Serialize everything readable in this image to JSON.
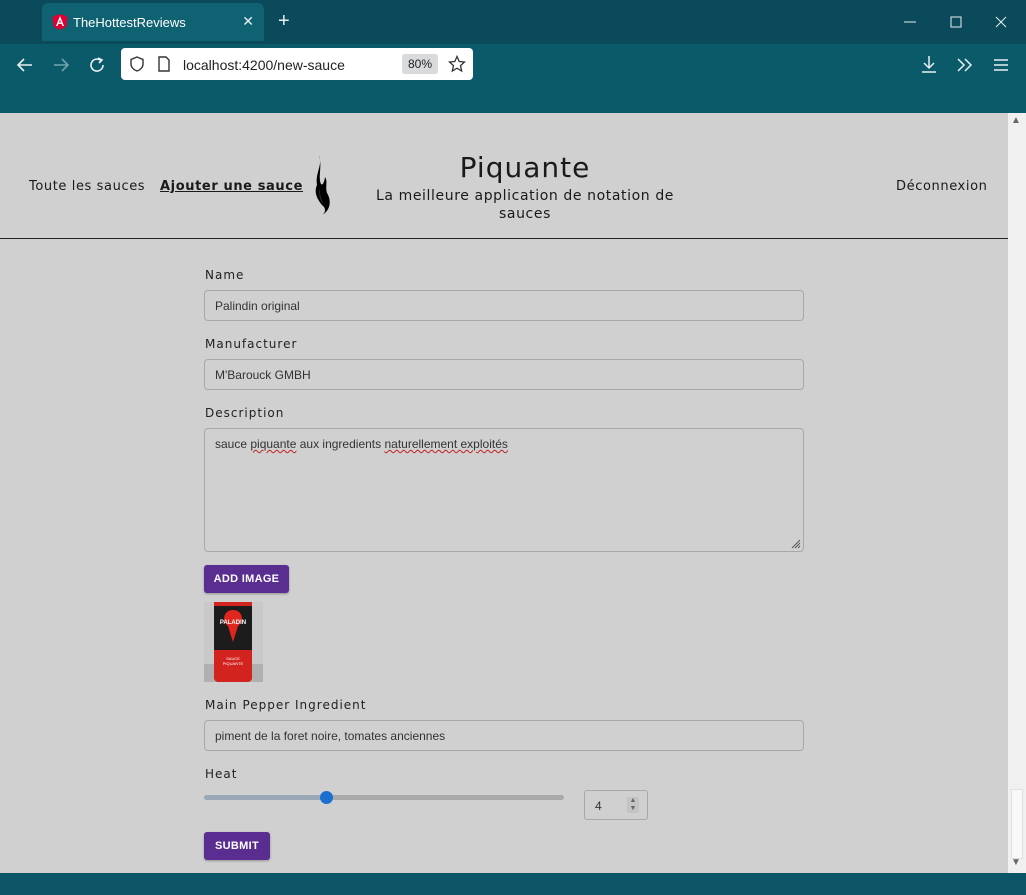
{
  "browser": {
    "tab_title": "TheHottestReviews",
    "tab_close": "✕",
    "new_tab": "+",
    "url": "localhost:4200/new-sauce",
    "zoom": "80%",
    "window_controls": [
      "minimize",
      "maximize",
      "close"
    ]
  },
  "header": {
    "nav_all": "Toute les sauces",
    "nav_add": "Ajouter une sauce",
    "title": "Piquante",
    "subtitle": "La meilleure application de notation de sauces",
    "logout": "Déconnexion"
  },
  "form": {
    "name_label": "Name",
    "name_value": "Palindin original",
    "manufacturer_label": "Manufacturer",
    "manufacturer_value": "M'Barouck GMBH",
    "description_label": "Description",
    "description_parts": [
      "sauce ",
      "piquante",
      " aux  ingredients ",
      "naturellement exploités"
    ],
    "add_image_label": "ADD IMAGE",
    "image_text": {
      "brand": "PALADIN",
      "line1": "SAUCE",
      "line2": "PIQUANTE"
    },
    "pepper_label": "Main Pepper Ingredient",
    "pepper_value": "piment  de la foret noire, tomates anciennes",
    "heat_label": "Heat",
    "heat_value": "4",
    "heat_min": 1,
    "heat_max": 10,
    "submit_label": "SUBMIT"
  },
  "colors": {
    "accent": "#5a2d91",
    "slider_knob": "#1a6fd1",
    "browser_chrome": "#0b5566"
  }
}
